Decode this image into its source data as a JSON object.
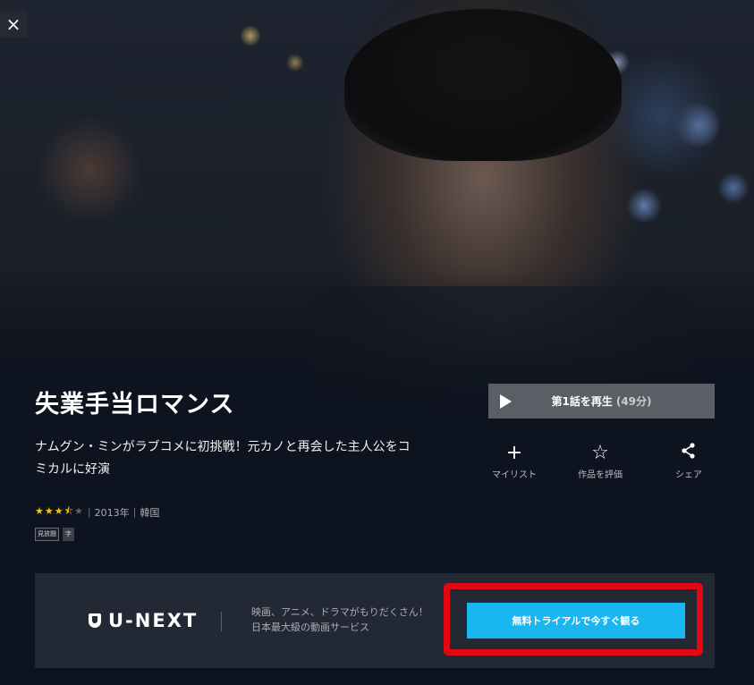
{
  "header": {
    "close_icon": "×"
  },
  "title": "失業手当ロマンス",
  "play": {
    "label": "第1話を再生",
    "duration": "(49分)"
  },
  "description": "ナムグン・ミンがラブコメに初挑戦！元カノと再会した主人公をコミカルに好演",
  "actions": [
    {
      "icon": "plus-icon",
      "glyph": "+",
      "label": "マイリスト"
    },
    {
      "icon": "star-outline-icon",
      "glyph": "☆",
      "label": "作品を評価"
    },
    {
      "icon": "share-icon",
      "glyph": "⋖",
      "label": "シェア"
    }
  ],
  "meta": {
    "rating": 3.5,
    "rating_max": 5,
    "year": "2013年",
    "country": "韓国"
  },
  "badges": [
    "見放題",
    "字"
  ],
  "promo": {
    "logo": "U-NEXT",
    "line1": "映画、アニメ、ドラマがもりだくさん！",
    "line2": "日本最大級の動画サービス",
    "cta": "無料トライアルで今すぐ観る",
    "highlight_color": "#e30613",
    "cta_color": "#19b6ef"
  }
}
